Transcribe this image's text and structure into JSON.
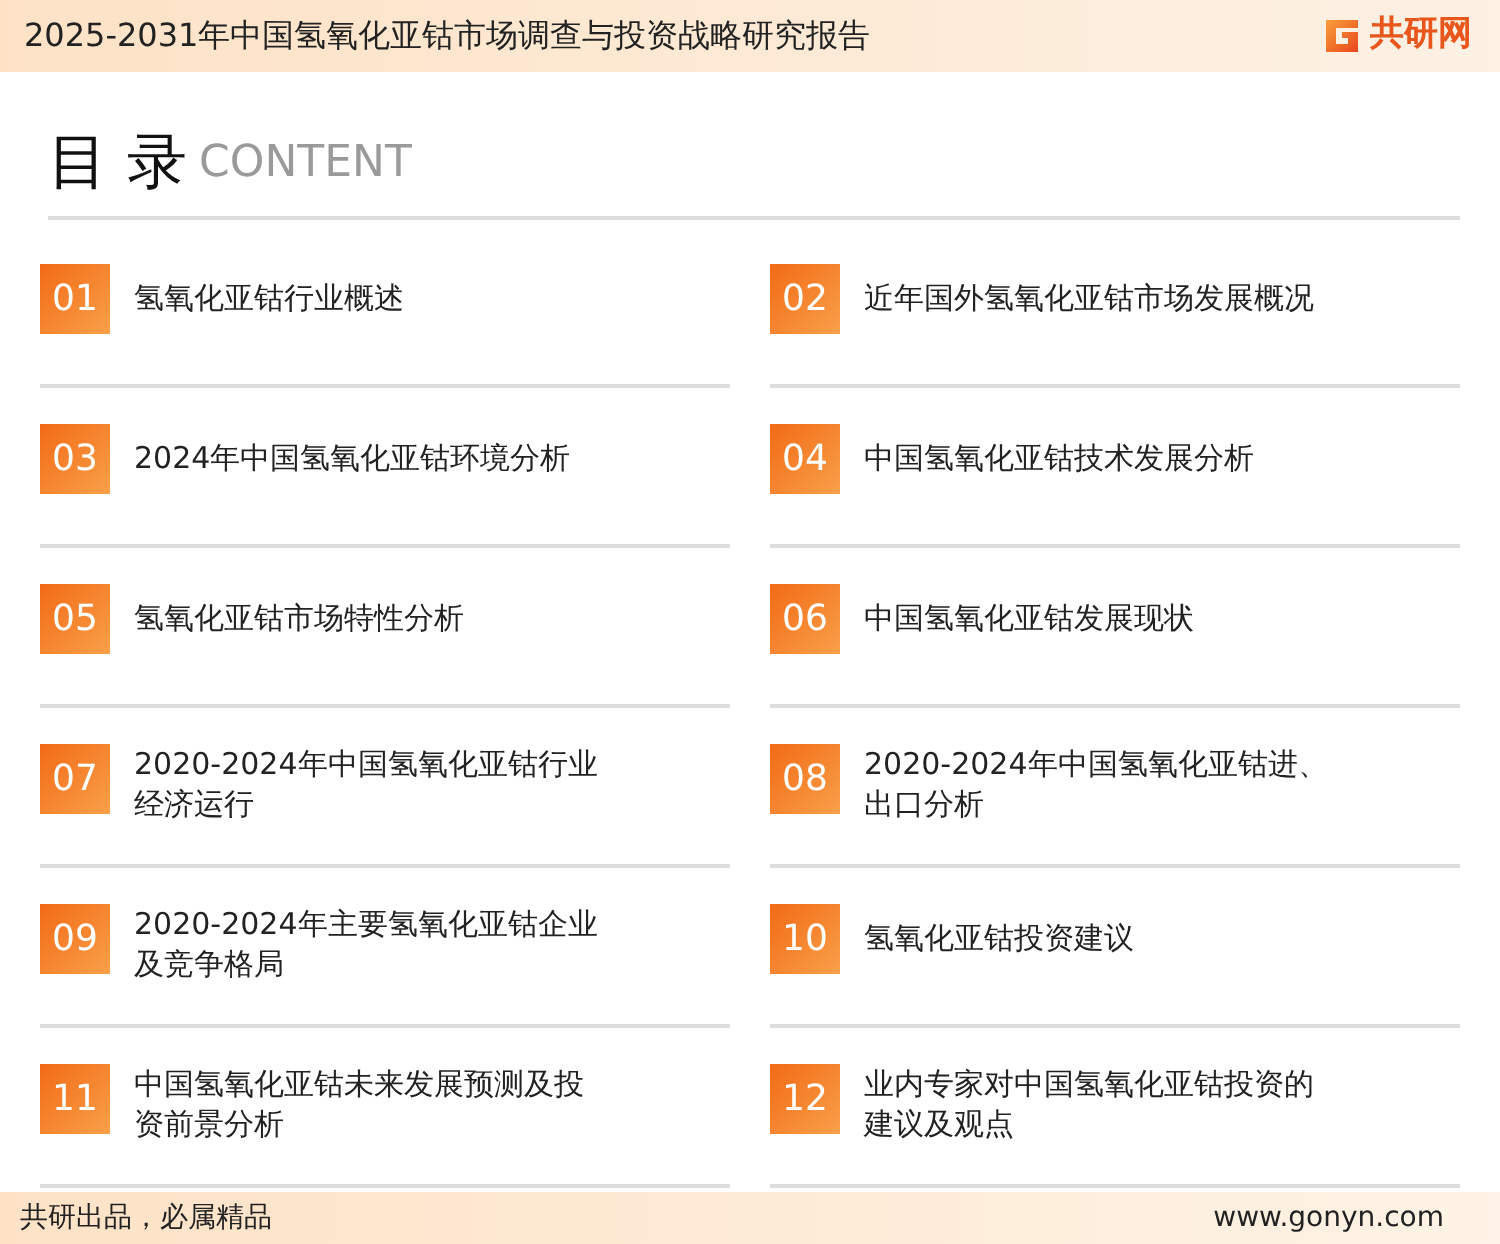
{
  "header": {
    "title": "2025-2031年中国氢氧化亚钴市场调查与投资战略研究报告",
    "logo_text": "共研网"
  },
  "heading": {
    "title": "目 录",
    "subtitle": "CONTENT"
  },
  "items": [
    {
      "number": "01",
      "label": "氢氧化亚钴行业概述"
    },
    {
      "number": "02",
      "label": "近年国外氢氧化亚钴市场发展概况"
    },
    {
      "number": "03",
      "label": "2024年中国氢氧化亚钴环境分析"
    },
    {
      "number": "04",
      "label": "中国氢氧化亚钴技术发展分析"
    },
    {
      "number": "05",
      "label": "氢氧化亚钴市场特性分析"
    },
    {
      "number": "06",
      "label": "中国氢氧化亚钴发展现状"
    },
    {
      "number": "07",
      "label": "2020-2024年中国氢氧化亚钴行业经济运行"
    },
    {
      "number": "08",
      "label": "2020-2024年中国氢氧化亚钴进、出口分析"
    },
    {
      "number": "09",
      "label": "2020-2024年主要氢氧化亚钴企业及竞争格局"
    },
    {
      "number": "10",
      "label": "氢氧化亚钴投资建议"
    },
    {
      "number": "11",
      "label": "中国氢氧化亚钴未来发展预测及投资前景分析"
    },
    {
      "number": "12",
      "label": "业内专家对中国氢氧化亚钴投资的建议及观点"
    }
  ],
  "footer": {
    "slogan": "共研出品，必属精品",
    "url": "www.gonyn.com"
  }
}
